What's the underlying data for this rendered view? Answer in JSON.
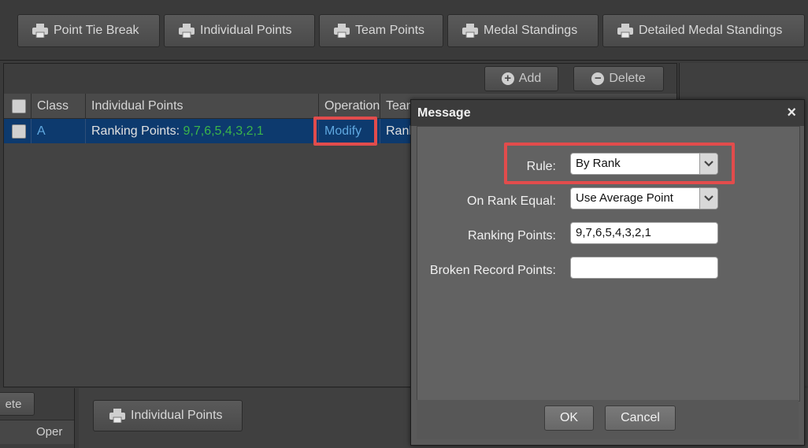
{
  "toolbar": {
    "buttons": [
      {
        "label": "Point Tie Break",
        "icon": "printer-icon"
      },
      {
        "label": "Individual Points",
        "icon": "printer-icon"
      },
      {
        "label": "Team Points",
        "icon": "printer-icon"
      },
      {
        "label": "Medal Standings",
        "icon": "printer-icon"
      },
      {
        "label": "Detailed Medal Standings",
        "icon": "printer-icon"
      }
    ]
  },
  "grid": {
    "add_label": "Add",
    "delete_label": "Delete",
    "columns": [
      "Class",
      "Individual Points",
      "Operation",
      "Team"
    ],
    "rows": [
      {
        "class": "A",
        "points_prefix": "Ranking Points:",
        "points_value": "9,7,6,5,4,3,2,1",
        "operation": "Modify",
        "team": "Rank"
      }
    ]
  },
  "bottom": {
    "delete_partial": "ete",
    "oper_partial": "Oper",
    "print_individual_points": "Individual Points"
  },
  "modal": {
    "title": "Message",
    "close_glyph": "×",
    "fields": {
      "rule_label": "Rule:",
      "rule_value": "By Rank",
      "rank_equal_label": "On Rank Equal:",
      "rank_equal_value": "Use Average Point",
      "ranking_points_label": "Ranking Points:",
      "ranking_points_value": "9,7,6,5,4,3,2,1",
      "broken_record_label": "Broken Record Points:",
      "broken_record_value": ""
    },
    "ok_label": "OK",
    "cancel_label": "Cancel"
  },
  "colors": {
    "highlight": "#e24c4c",
    "row_selected": "#0d3a6e",
    "points_green": "#3bb54a",
    "link_blue": "#5fa8e0"
  }
}
